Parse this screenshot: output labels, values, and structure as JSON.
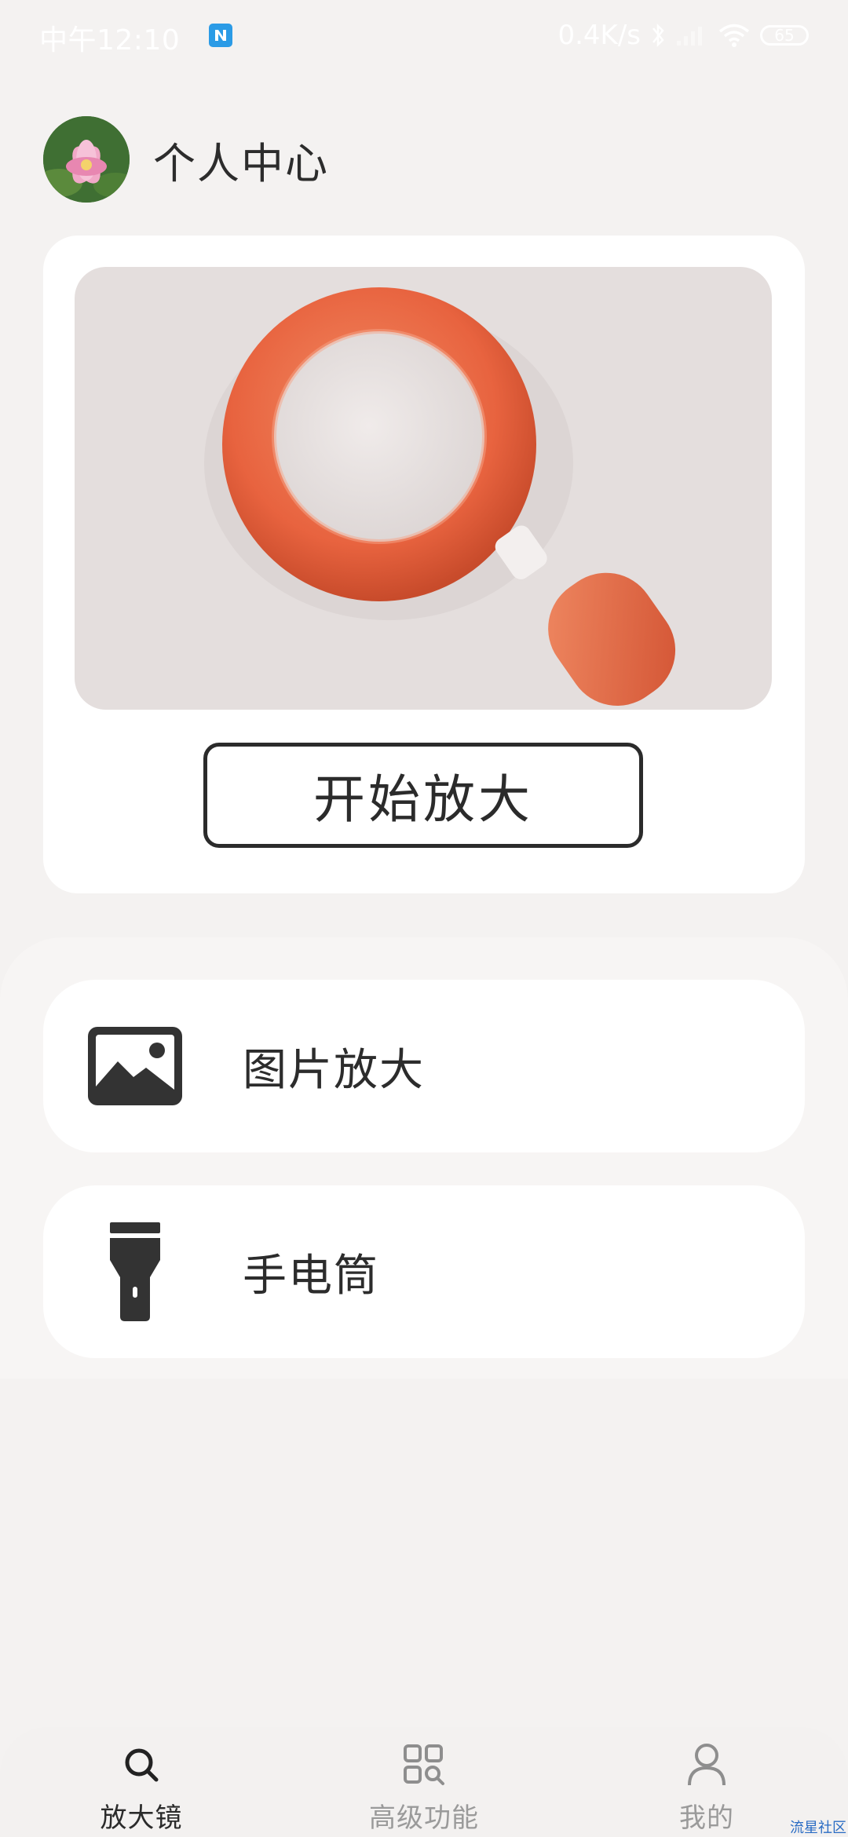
{
  "status_bar": {
    "time": "中午12:10",
    "network_speed": "0.4K/s",
    "battery": "65",
    "icons": [
      "app-notification-icon",
      "bluetooth-icon",
      "signal-icon",
      "wifi-icon",
      "battery-icon"
    ]
  },
  "header": {
    "title": "个人中心",
    "avatar": "lotus-flower-avatar"
  },
  "hero": {
    "image": "orange-magnifying-glass-3d",
    "start_button_label": "开始放大",
    "accent_color": "#e8633f"
  },
  "features": [
    {
      "label": "图片放大",
      "icon": "image-icon"
    },
    {
      "label": "手电筒",
      "icon": "flashlight-icon"
    }
  ],
  "bottom_nav": {
    "items": [
      {
        "label": "放大镜",
        "icon": "search-icon",
        "active": true
      },
      {
        "label": "高级功能",
        "icon": "apps-search-icon",
        "active": false
      },
      {
        "label": "我的",
        "icon": "user-icon",
        "active": false
      }
    ]
  },
  "watermark": "流星社区"
}
